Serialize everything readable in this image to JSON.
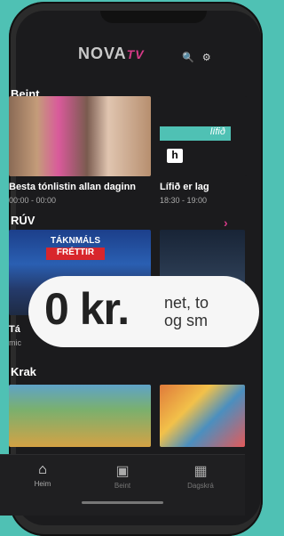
{
  "header": {
    "logo_text": "NOVA",
    "logo_suffix": "TV",
    "search_icon": "search-icon",
    "settings_icon": "gear-icon"
  },
  "sections": [
    {
      "title": "Beint",
      "items": [
        {
          "caption": "Besta tónlistin allan daginn",
          "time": "00:00 - 00:00"
        },
        {
          "caption": "Lífið er lag",
          "time": "18:30 - 19:00"
        }
      ]
    },
    {
      "title": "RÚV",
      "items": [
        {
          "thumb_top": "TÁKNMÁLS",
          "thumb_badge": "FRÉTTIR",
          "caption": "Tá"
        }
      ]
    },
    {
      "title": "Krak",
      "items": []
    }
  ],
  "promo": {
    "price": "0 kr.",
    "line1": "net, to",
    "line2": "og sm"
  },
  "side_text": {
    "lifid": "lífið",
    "lifid_sub": "Hagamusic",
    "h_badge": "h"
  },
  "ruv_sub": "mic",
  "nav": [
    {
      "label": "Heim",
      "icon": "home-icon",
      "active": true
    },
    {
      "label": "Beint",
      "icon": "tv-icon",
      "active": false
    },
    {
      "label": "Dagskrá",
      "icon": "calendar-icon",
      "active": false
    }
  ]
}
